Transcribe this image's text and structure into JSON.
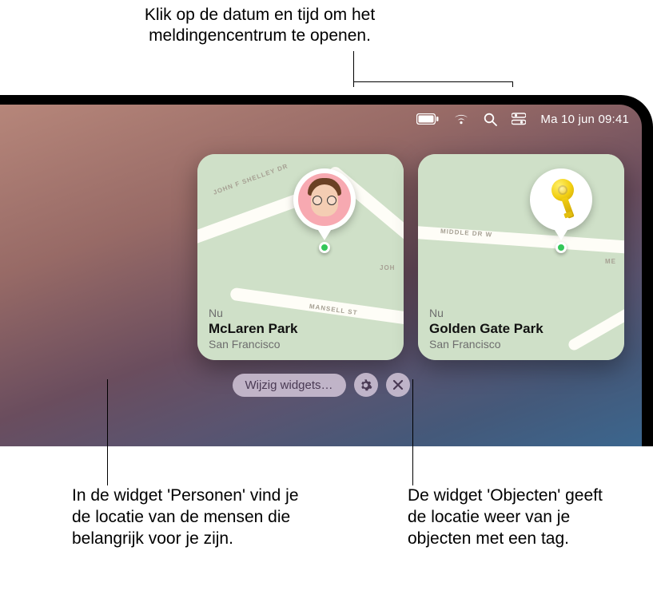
{
  "captions": {
    "top": "Klik op de datum en tijd om het meldingencentrum te openen.",
    "left": "In de widget 'Personen' vind je de locatie van de mensen die belangrijk voor je zijn.",
    "right": "De widget 'Objecten' geeft de locatie weer van je objecten met een tag."
  },
  "menubar": {
    "datetime": "Ma 10 jun  09:41"
  },
  "widgets": {
    "people": {
      "now": "Nu",
      "title": "McLaren Park",
      "subtitle": "San Francisco",
      "streets": {
        "a": "JOHN F SHELLEY DR",
        "b": "MANSELL ST",
        "c": "JOH"
      }
    },
    "items": {
      "now": "Nu",
      "title": "Golden Gate Park",
      "subtitle": "San Francisco",
      "streets": {
        "a": "MIDDLE DR W",
        "b": "ME"
      }
    }
  },
  "editbar": {
    "label": "Wijzig widgets…"
  }
}
